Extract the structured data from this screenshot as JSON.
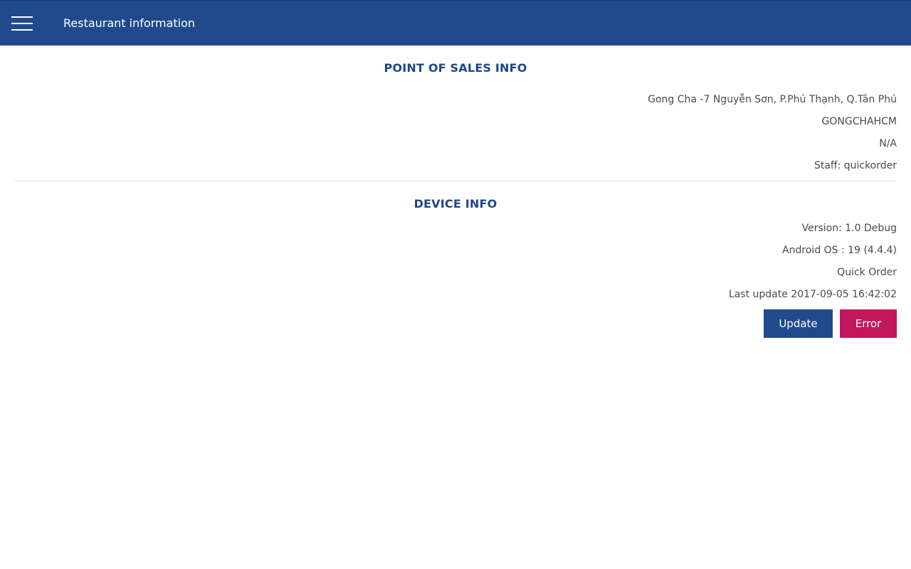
{
  "header": {
    "menu_icon": "hamburger-menu-icon",
    "title": "Restaurant information",
    "bg_color": "#214a8d"
  },
  "pos_info": {
    "heading": "POINT OF SALES INFO",
    "address": "Gong Cha -7 Nguyễn Sơn, P.Phú Thạnh, Q.Tân Phú",
    "code": "GONGCHAHCM",
    "extra": "N/A",
    "staff": "Staff: quickorder"
  },
  "device_info": {
    "heading": "DEVICE INFO",
    "version": "Version: 1.0 Debug",
    "android_os": "Android OS : 19 (4.4.4)",
    "app_name": "Quick Order",
    "last_update": "Last update 2017-09-05 16:42:02"
  },
  "actions": {
    "update_label": "Update",
    "error_label": "Error",
    "update_color": "#214a8d",
    "error_color": "#c2185b"
  }
}
